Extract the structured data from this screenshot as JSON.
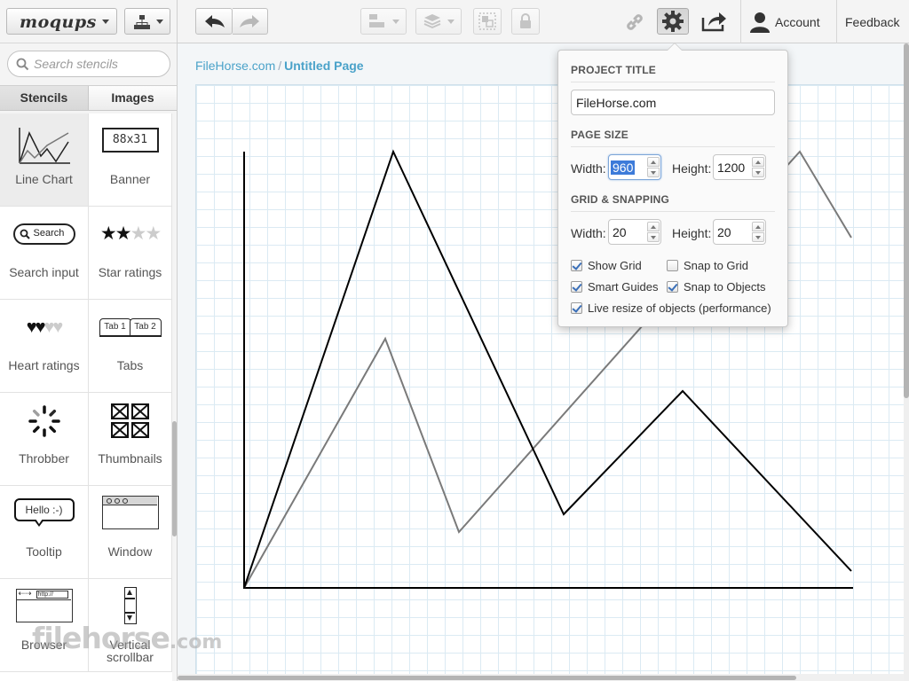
{
  "app": {
    "logo": "moqups"
  },
  "sidebar": {
    "search_placeholder": "Search stencils",
    "tabs": [
      {
        "label": "Stencils",
        "active": true
      },
      {
        "label": "Images",
        "active": false
      }
    ],
    "stencils": [
      {
        "label": "Line Chart",
        "icon": "line-chart-icon"
      },
      {
        "label": "Banner",
        "icon": "banner-icon",
        "icon_text": "88x31"
      },
      {
        "label": "Search input",
        "icon": "search-input-icon",
        "icon_text": "Search"
      },
      {
        "label": "Star ratings",
        "icon": "star-ratings-icon"
      },
      {
        "label": "Heart ratings",
        "icon": "heart-ratings-icon"
      },
      {
        "label": "Tabs",
        "icon": "tabs-icon",
        "icon_text_1": "Tab 1",
        "icon_text_2": "Tab 2"
      },
      {
        "label": "Throbber",
        "icon": "throbber-icon"
      },
      {
        "label": "Thumbnails",
        "icon": "thumbnails-icon"
      },
      {
        "label": "Tooltip",
        "icon": "tooltip-icon",
        "icon_text": "Hello :-)"
      },
      {
        "label": "Window",
        "icon": "window-icon"
      },
      {
        "label": "Browser",
        "icon": "browser-icon",
        "icon_text": "http://"
      },
      {
        "label": "Vertical scrollbar",
        "icon": "vertical-scrollbar-icon"
      }
    ]
  },
  "toolbar": {
    "account_label": "Account",
    "feedback_label": "Feedback"
  },
  "breadcrumb": {
    "project": "FileHorse.com",
    "separator": "/",
    "page": "Untitled Page"
  },
  "settings": {
    "project_title_heading": "PROJECT TITLE",
    "project_title_value": "FileHorse.com",
    "page_size_heading": "PAGE SIZE",
    "page_width_label": "Width:",
    "page_width_value": "960",
    "page_height_label": "Height:",
    "page_height_value": "1200",
    "grid_heading": "GRID & SNAPPING",
    "grid_width_label": "Width:",
    "grid_width_value": "20",
    "grid_height_label": "Height:",
    "grid_height_value": "20",
    "options": [
      {
        "label": "Show Grid",
        "checked": true
      },
      {
        "label": "Snap to Grid",
        "checked": false
      },
      {
        "label": "Smart Guides",
        "checked": true
      },
      {
        "label": "Snap to Objects",
        "checked": true
      },
      {
        "label": "Live resize of objects (performance)",
        "checked": true
      }
    ]
  },
  "watermark": {
    "brand": "filehorse",
    "domain": ".com"
  },
  "colors": {
    "link": "#4aa2c9",
    "selection": "#3d7bd9",
    "grid": "#dbeaf3",
    "series_primary": "#000000",
    "series_secondary": "#7a7a7a"
  }
}
